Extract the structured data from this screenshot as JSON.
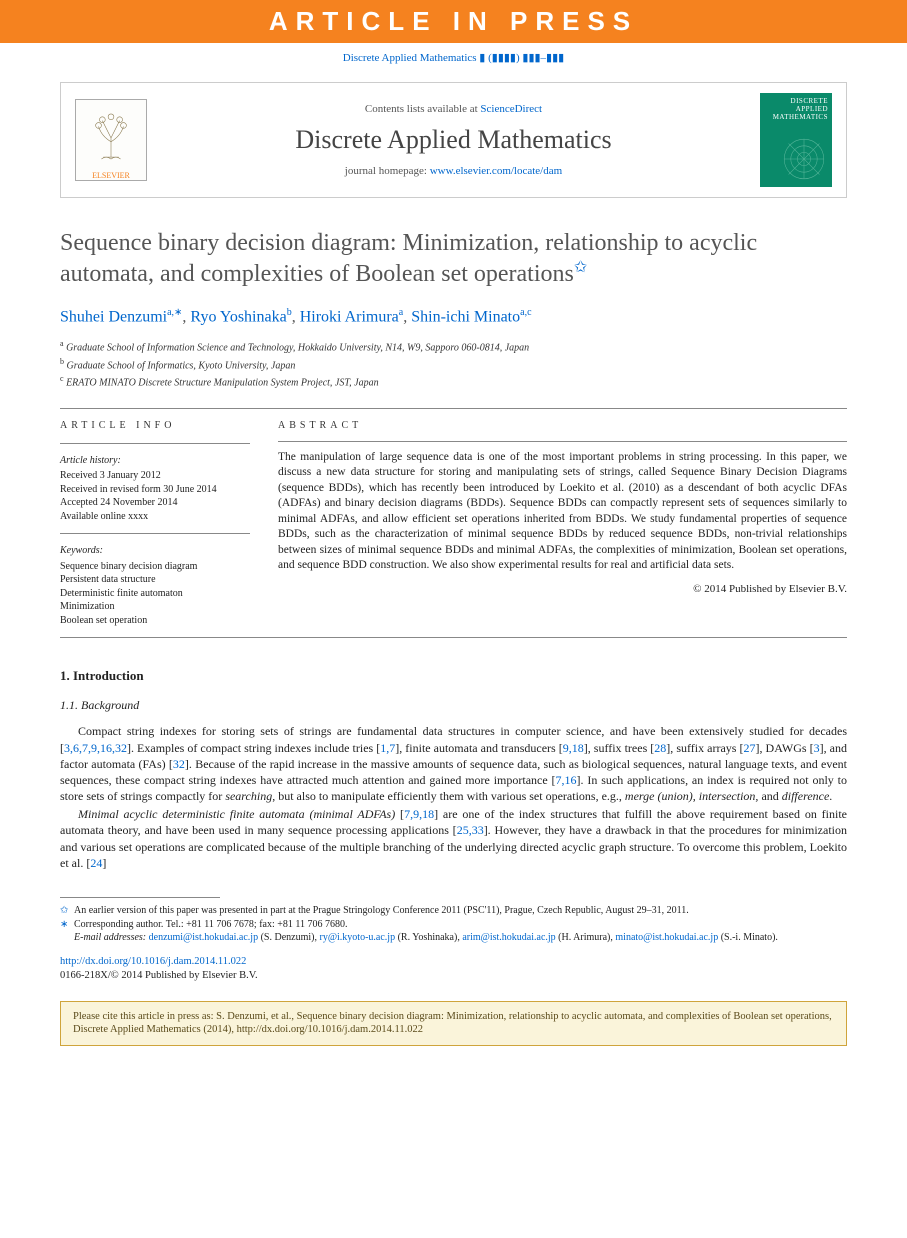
{
  "banner": "ARTICLE IN PRESS",
  "journal_ref": "Discrete Applied Mathematics ▮ (▮▮▮▮) ▮▮▮–▮▮▮",
  "header": {
    "contents_prefix": "Contents lists available at ",
    "sciencedirect": "ScienceDirect",
    "journal_title": "Discrete Applied Mathematics",
    "homepage_prefix": "journal homepage: ",
    "homepage_url": "www.elsevier.com/locate/dam",
    "elsevier": "ELSEVIER",
    "cover_title": "DISCRETE APPLIED MATHEMATICS"
  },
  "title": "Sequence binary decision diagram: Minimization, relationship to acyclic automata, and complexities of Boolean set operations",
  "title_star": "✩",
  "authors": [
    {
      "name": "Shuhei Denzumi",
      "sup": "a,∗"
    },
    {
      "name": "Ryo Yoshinaka",
      "sup": "b"
    },
    {
      "name": "Hiroki Arimura",
      "sup": "a"
    },
    {
      "name": "Shin-ichi Minato",
      "sup": "a,c"
    }
  ],
  "affiliations": [
    {
      "sup": "a",
      "text": "Graduate School of Information Science and Technology, Hokkaido University, N14, W9, Sapporo 060-0814, Japan"
    },
    {
      "sup": "b",
      "text": "Graduate School of Informatics, Kyoto University, Japan"
    },
    {
      "sup": "c",
      "text": "ERATO MINATO Discrete Structure Manipulation System Project, JST, Japan"
    }
  ],
  "info": {
    "label": "ARTICLE INFO",
    "history_title": "Article history:",
    "history": [
      "Received 3 January 2012",
      "Received in revised form 30 June 2014",
      "Accepted 24 November 2014",
      "Available online xxxx"
    ],
    "keywords_title": "Keywords:",
    "keywords": [
      "Sequence binary decision diagram",
      "Persistent data structure",
      "Deterministic finite automaton",
      "Minimization",
      "Boolean set operation"
    ]
  },
  "abstract": {
    "label": "ABSTRACT",
    "text": "The manipulation of large sequence data is one of the most important problems in string processing. In this paper, we discuss a new data structure for storing and manipulating sets of strings, called Sequence Binary Decision Diagrams (sequence BDDs), which has recently been introduced by Loekito et al. (2010) as a descendant of both acyclic DFAs (ADFAs) and binary decision diagrams (BDDs). Sequence BDDs can compactly represent sets of sequences similarly to minimal ADFAs, and allow efficient set operations inherited from BDDs. We study fundamental properties of sequence BDDs, such as the characterization of minimal sequence BDDs by reduced sequence BDDs, non-trivial relationships between sizes of minimal sequence BDDs and minimal ADFAs, the complexities of minimization, Boolean set operations, and sequence BDD construction. We also show experimental results for real and artificial data sets.",
    "copyright": "© 2014 Published by Elsevier B.V."
  },
  "sections": {
    "s1": "1.  Introduction",
    "s1_1": "1.1.  Background"
  },
  "body": {
    "p1_pre": "Compact string indexes for storing sets of strings are fundamental data structures in computer science, and have been extensively studied for decades [",
    "p1_ref1": "3,6,7,9,16,32",
    "p1_mid1": "]. Examples of compact string indexes include tries [",
    "p1_ref2": "1,7",
    "p1_mid2": "], finite automata and transducers [",
    "p1_ref3": "9,18",
    "p1_mid3": "], suffix trees [",
    "p1_ref4": "28",
    "p1_mid4": "], suffix arrays [",
    "p1_ref5": "27",
    "p1_mid5": "], DAWGs [",
    "p1_ref6": "3",
    "p1_mid6": "], and factor automata (FAs) [",
    "p1_ref7": "32",
    "p1_mid7": "]. Because of the rapid increase in the massive amounts of sequence data, such as biological sequences, natural language texts, and event sequences, these compact string indexes have attracted much attention and gained more importance [",
    "p1_ref8": "7,16",
    "p1_mid8": "]. In such applications, an index is required not only to store sets of strings compactly for ",
    "p1_it1": "searching",
    "p1_mid9": ", but also to manipulate efficiently them with various set operations, e.g., ",
    "p1_it2": "merge (union), intersection,",
    "p1_mid10": " and ",
    "p1_it3": "difference",
    "p1_end": ".",
    "p2_it1": "Minimal acyclic deterministic finite automata (minimal ADFAs)",
    "p2_mid1": " [",
    "p2_ref1": "7,9,18",
    "p2_mid2": "] are one of the index structures that fulfill the above requirement based on finite automata theory, and have been used in many sequence processing applications [",
    "p2_ref2": "25,33",
    "p2_mid3": "]. However, they have a drawback in that the procedures for minimization and various set operations are complicated because of the multiple branching of the underlying directed acyclic graph structure. To overcome this problem, Loekito et al. [",
    "p2_ref3": "24",
    "p2_end": "]"
  },
  "footnotes": {
    "f1_sym": "✩",
    "f1": "An earlier version of this paper was presented in part at the Prague Stringology Conference 2011 (PSC'11), Prague, Czech Republic, August 29–31, 2011.",
    "f2_sym": "∗",
    "f2": "Corresponding author. Tel.: +81 11 706 7678; fax: +81 11 706 7680.",
    "email_label": "E-mail addresses:",
    "emails": [
      {
        "addr": "denzumi@ist.hokudai.ac.jp",
        "who": "(S. Denzumi)"
      },
      {
        "addr": "ry@i.kyoto-u.ac.jp",
        "who": "(R. Yoshinaka)"
      },
      {
        "addr": "arim@ist.hokudai.ac.jp",
        "who": "(H. Arimura)"
      },
      {
        "addr": "minato@ist.hokudai.ac.jp",
        "who": "(S.-i. Minato)."
      }
    ]
  },
  "doi": {
    "url": "http://dx.doi.org/10.1016/j.dam.2014.11.022",
    "issn_line": "0166-218X/© 2014 Published by Elsevier B.V."
  },
  "citebox": "Please cite this article in press as: S. Denzumi, et al., Sequence binary decision diagram: Minimization, relationship to acyclic automata, and complexities of Boolean set operations, Discrete Applied Mathematics (2014), http://dx.doi.org/10.1016/j.dam.2014.11.022"
}
